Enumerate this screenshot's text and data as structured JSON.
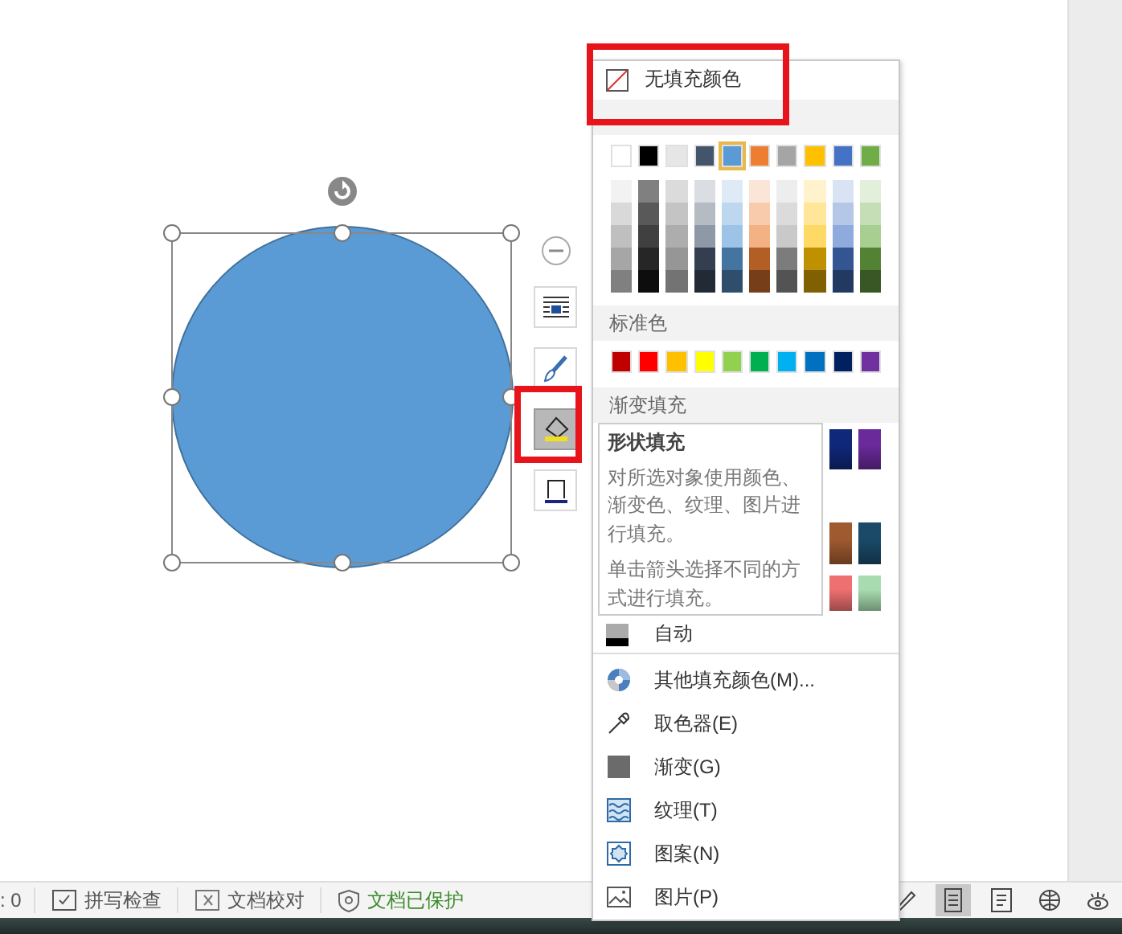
{
  "side_toolbar": [
    {
      "kind": "collapse",
      "selected": false
    },
    {
      "kind": "layout",
      "selected": false
    },
    {
      "kind": "brush",
      "selected": false
    },
    {
      "kind": "fill",
      "selected": true
    },
    {
      "kind": "outline",
      "selected": false
    }
  ],
  "fill_menu": {
    "no_fill": "无填充颜色",
    "theme_colors": [
      {
        "color": "#ffffff",
        "selected": false
      },
      {
        "color": "#000000",
        "selected": false
      },
      {
        "color": "#e7e6e6",
        "selected": false
      },
      {
        "color": "#44546a",
        "selected": false
      },
      {
        "color": "#5b9bd5",
        "selected": true
      },
      {
        "color": "#ed7d31",
        "selected": false
      },
      {
        "color": "#a5a5a5",
        "selected": false
      },
      {
        "color": "#ffc000",
        "selected": false
      },
      {
        "color": "#4472c4",
        "selected": false
      },
      {
        "color": "#70ad47",
        "selected": false
      }
    ],
    "standard_header": "标准色",
    "standard_colors": [
      {
        "color": "#c00000"
      },
      {
        "color": "#ff0000"
      },
      {
        "color": "#ffc000"
      },
      {
        "color": "#ffff00"
      },
      {
        "color": "#92d050"
      },
      {
        "color": "#00b050"
      },
      {
        "color": "#00b0f0"
      },
      {
        "color": "#0070c0"
      },
      {
        "color": "#002060"
      },
      {
        "color": "#7030a0"
      }
    ],
    "gradient_header": "渐变填充",
    "gradient_rows": [
      [
        {
          "color": "#10287a"
        },
        {
          "color": "#6a2a9a"
        }
      ],
      [
        {
          "color": "#a05a30"
        },
        {
          "color": "#1a4a68"
        }
      ],
      [
        {
          "color": "#ee7070"
        },
        {
          "color": "#a8dcb0"
        }
      ]
    ],
    "auto": "自动",
    "items": [
      {
        "kind": "palette",
        "label": "其他填充颜色(M)..."
      },
      {
        "kind": "eyedropper",
        "label": "取色器(E)"
      },
      {
        "kind": "gradient",
        "label": "渐变(G)"
      },
      {
        "kind": "texture",
        "label": "纹理(T)"
      },
      {
        "kind": "pattern",
        "label": "图案(N)"
      },
      {
        "kind": "picture",
        "label": "图片(P)"
      }
    ]
  },
  "tooltip": {
    "title": "形状填充",
    "description": "对所选对象使用颜色、渐变色、纹理、图片进行填充。",
    "hint": "单击箭头选择不同的方式进行填充。"
  },
  "status_bar": {
    "word_count": ": 0",
    "spell_check": "拼写检查",
    "proofread": "文档校对",
    "protected": "文档已保护",
    "view_buttons": [
      {
        "kind": "pen",
        "selected": false
      },
      {
        "kind": "page",
        "selected": true
      },
      {
        "kind": "outline",
        "selected": false
      },
      {
        "kind": "web",
        "selected": false
      },
      {
        "kind": "read",
        "selected": false
      }
    ]
  }
}
